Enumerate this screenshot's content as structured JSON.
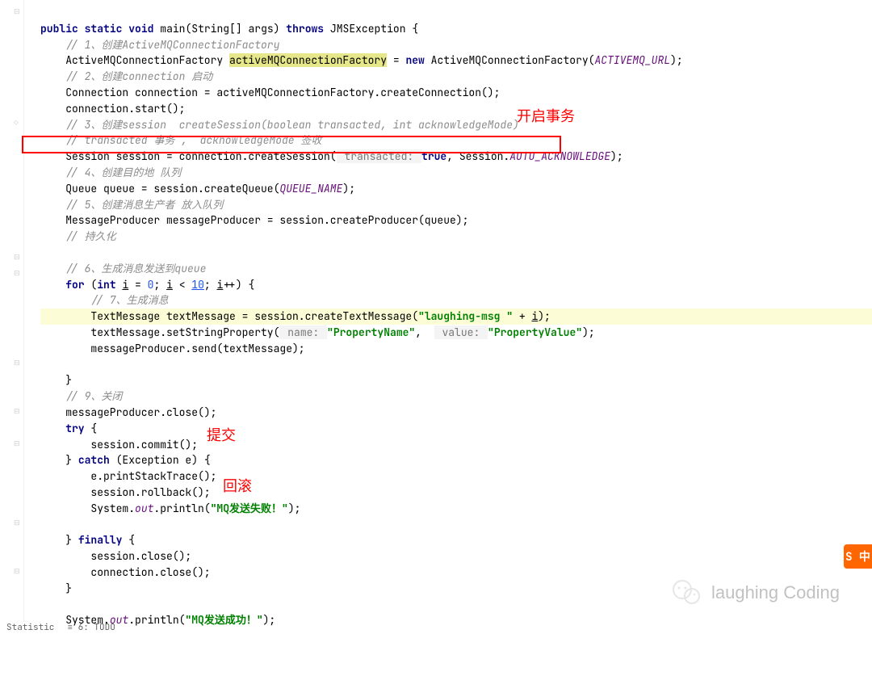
{
  "code": {
    "line1_public": "public",
    "line1_static": "static",
    "line1_void": "void",
    "line1_main": "main",
    "line1_args": "(String[] args)",
    "line1_throws": "throws",
    "line1_exception": "JMSException {",
    "comment1": "// 1、创建ActiveMQConnectionFactory",
    "line3_type": "ActiveMQConnectionFactory",
    "line3_var": "activeMQConnectionFactory",
    "line3_new": "new",
    "line3_ctor": "ActiveMQConnectionFactory(",
    "line3_const": "ACTIVEMQ_URL",
    "line3_end": ");",
    "comment2": "// 2、创建connection 启动",
    "line5": "Connection connection = activeMQConnectionFactory.createConnection();",
    "line6": "connection.start();",
    "comment3": "// 3、创建session  createSession(boolean transacted, int acknowledgeMode)",
    "comment4": "// transacted 事务 ,  acknowledgeMode 签收",
    "line9_pre": "Session session = connection.createSession(",
    "line9_hint": " transacted: ",
    "line9_true": "true",
    "line9_mid": ", Session.",
    "line9_ack": "AUTO_ACKNOWLEDGE",
    "line9_end": ");",
    "comment5": "// 4、创建目的地 队列",
    "line11_pre": "Queue queue = session.createQueue(",
    "line11_const": "QUEUE_NAME",
    "line11_end": ");",
    "comment6": "// 5、创建消息生产者 放入队列",
    "line13": "MessageProducer messageProducer = session.createProducer(queue);",
    "comment7": "// 持久化",
    "comment8": "// 6、生成消息发送到queue",
    "line16_for": "for",
    "line16_int": "int",
    "line16_i1": "i",
    "line16_eq": " = ",
    "line16_zero": "0",
    "line16_semi": "; ",
    "line16_i2": "i",
    "line16_lt": " < ",
    "line16_ten": "10",
    "line16_semi2": "; ",
    "line16_i3": "i",
    "line16_inc": "++) {",
    "comment9": "// 7、生成消息",
    "line18_pre": "TextMessage textMessage = session.createTextMessage(",
    "line18_str": "\"laughing-msg \"",
    "line18_plus": " + ",
    "line18_i": "i",
    "line18_end": ");",
    "line19_pre": "textMessage.setStringProperty(",
    "line19_hint1": " name: ",
    "line19_str1": "\"PropertyName\"",
    "line19_comma": ",  ",
    "line19_hint2": " value: ",
    "line19_str2": "\"PropertyValue\"",
    "line19_end": ");",
    "line20": "messageProducer.send(textMessage);",
    "line21": "}",
    "comment10": "// 9、关闭",
    "line23": "messageProducer.close();",
    "line24_try": "try",
    "line24_brace": " {",
    "line25": "session.commit();",
    "line26_close": "} ",
    "line26_catch": "catch",
    "line26_rest": " (Exception e) {",
    "line27": "e.printStackTrace();",
    "line28": "session.rollback();",
    "line29_pre": "System.",
    "line29_out": "out",
    "line29_mid": ".println(",
    "line29_str": "\"MQ发送失败！\"",
    "line29_end": ");",
    "line30_close": "} ",
    "line30_finally": "finally",
    "line30_brace": " {",
    "line31": "session.close();",
    "line32": "connection.close();",
    "line33": "}",
    "line34_pre": "System.",
    "line34_out": "out",
    "line34_mid": ".println(",
    "line34_str": "\"MQ发送成功！\"",
    "line34_end": ");"
  },
  "annotations": {
    "open_tx": "开启事务",
    "commit": "提交",
    "rollback": "回滚"
  },
  "watermark": "laughing Coding",
  "tabs": {
    "statistic": "Statistic",
    "todo": "≡ 6: TODO"
  },
  "badge": "S 中"
}
